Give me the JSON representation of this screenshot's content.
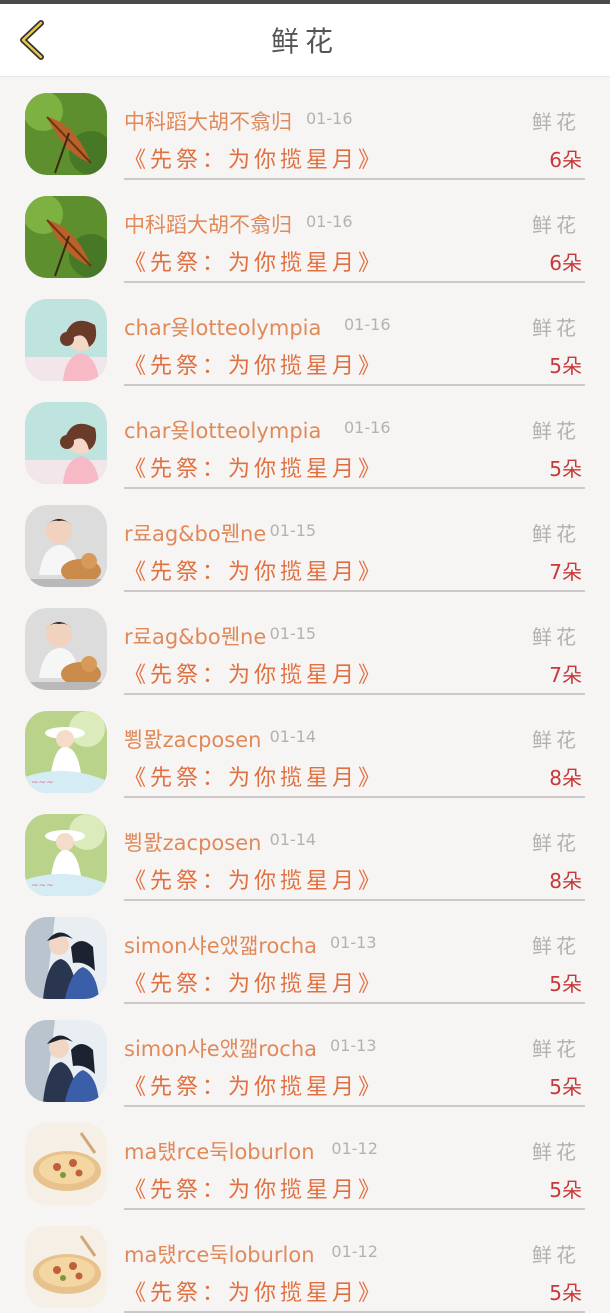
{
  "header": {
    "title": "鲜花"
  },
  "gift_label": "鲜花",
  "message": "《先祭：为你揽星月》",
  "rows": [
    {
      "name": "中科蹈大胡不翕归",
      "date": "01-16",
      "count": "6朵",
      "avatar": "autumn-leaf"
    },
    {
      "name": "中科蹈大胡不翕归",
      "date": "01-16",
      "count": "6朵",
      "avatar": "autumn-leaf"
    },
    {
      "name": "char욪lotteolympia",
      "date": "01-16",
      "count": "5朵",
      "avatar": "girl-illustration"
    },
    {
      "name": "char욪lotteolympia",
      "date": "01-16",
      "count": "5朵",
      "avatar": "girl-illustration"
    },
    {
      "name": "r료ag&bo뭰ne",
      "date": "01-15",
      "count": "7朵",
      "avatar": "child-with-dog"
    },
    {
      "name": "r료ag&bo뭰ne",
      "date": "01-15",
      "count": "7朵",
      "avatar": "child-with-dog"
    },
    {
      "name": "뾩뫐zacposen",
      "date": "01-14",
      "count": "8朵",
      "avatar": "girl-with-hat"
    },
    {
      "name": "뾩뫐zacposen",
      "date": "01-14",
      "count": "8朵",
      "avatar": "girl-with-hat"
    },
    {
      "name": "simon샤e앴깳rocha",
      "date": "01-13",
      "count": "5朵",
      "avatar": "anime-couple"
    },
    {
      "name": "simon샤e앴깳rocha",
      "date": "01-13",
      "count": "5朵",
      "avatar": "anime-couple"
    },
    {
      "name": "ma턨rce둑loburlon",
      "date": "01-12",
      "count": "5朵",
      "avatar": "pizza"
    },
    {
      "name": "ma턨rce둑loburlon",
      "date": "01-12",
      "count": "5朵",
      "avatar": "pizza"
    }
  ]
}
